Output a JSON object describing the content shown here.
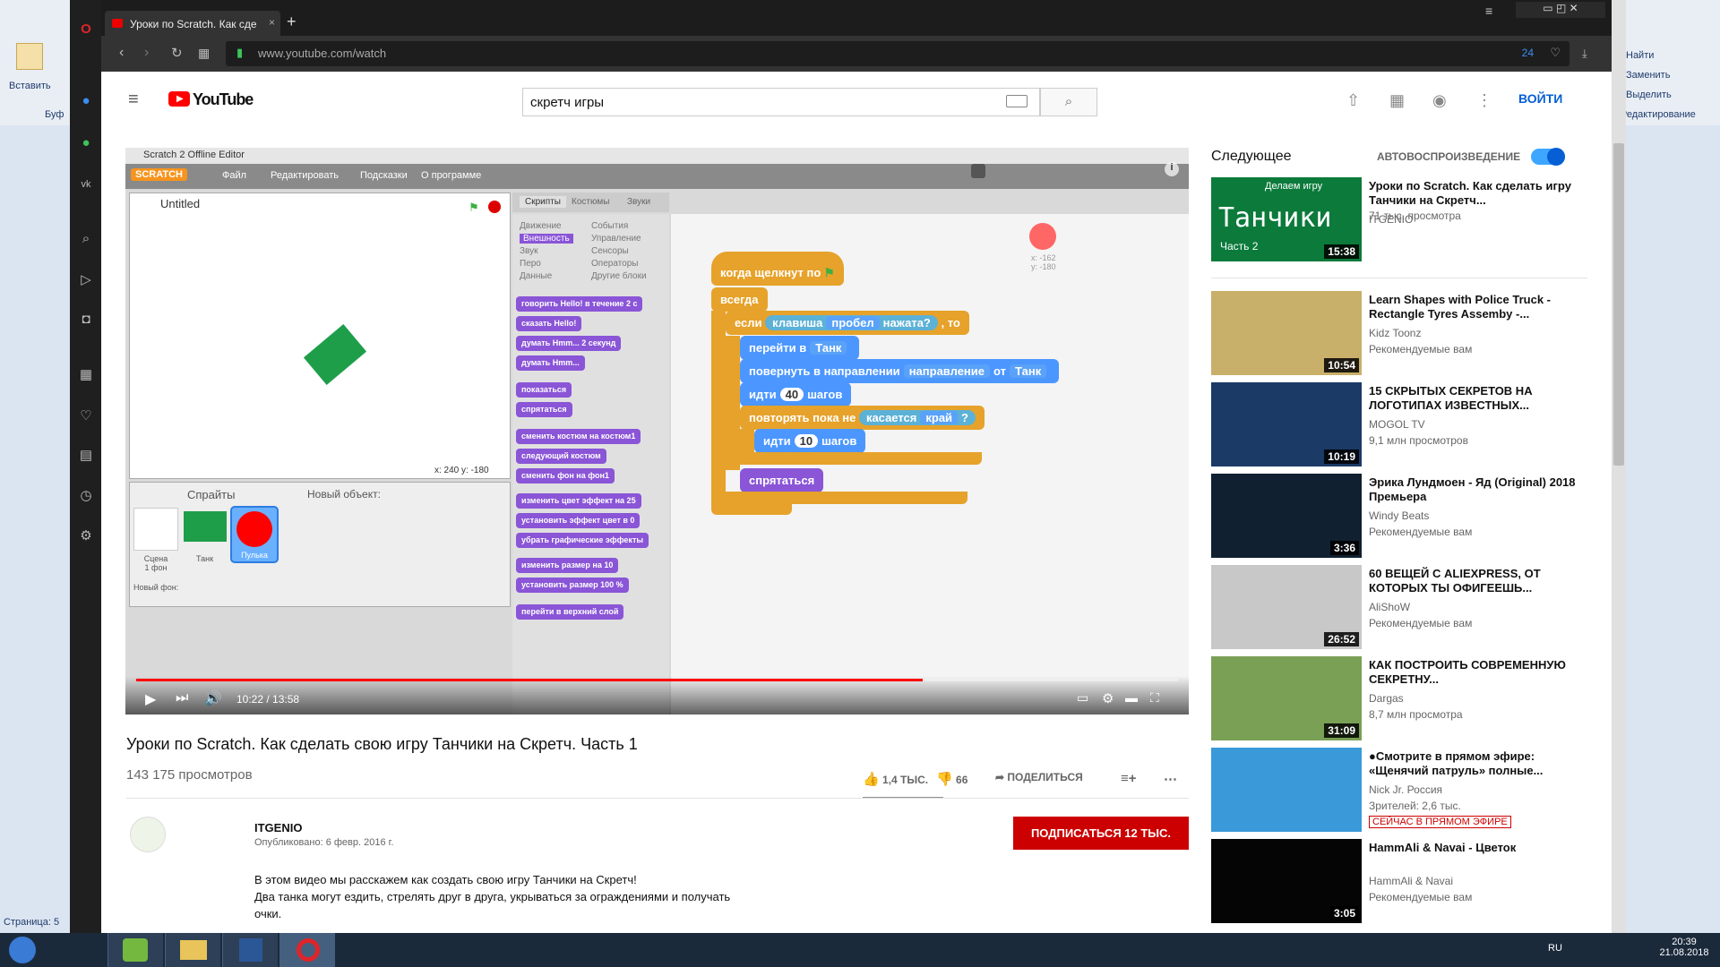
{
  "word": {
    "paste_label": "Вставить",
    "buffer_label": "Буф",
    "page_label": "Страница: 5",
    "right_items": [
      "Найти",
      "Заменить",
      "Выделить",
      "Редактирование"
    ]
  },
  "browser": {
    "tab_title": "Уроки по Scratch. Как сде",
    "url": "www.youtube.com/watch",
    "badge_count": "24"
  },
  "youtube": {
    "logo": "YouTube",
    "search_value": "скретч игры",
    "signin": "ВОЙТИ"
  },
  "video": {
    "scratch_window_title": "Scratch 2 Offline Editor",
    "menu": [
      "Файл",
      "Редактировать",
      "Подсказки",
      "О программе"
    ],
    "project_name": "Untitled",
    "tabs": [
      "Скрипты",
      "Костюмы",
      "Звуки"
    ],
    "categories_left": [
      "Движение",
      "Внешность",
      "Звук",
      "Перо",
      "Данные"
    ],
    "categories_right": [
      "События",
      "Управление",
      "Сенсоры",
      "Операторы",
      "Другие блоки"
    ],
    "palette_blocks": [
      "говорить Hello! в течение 2 с",
      "сказать Hello!",
      "думать Hmm... 2 секунд",
      "думать Hmm...",
      "показаться",
      "спрятаться",
      "сменить костюм на костюм1",
      "следующий костюм",
      "сменить фон на фон1",
      "изменить цвет эффект на 25",
      "установить эффект цвет в 0",
      "убрать графические эффекты",
      "изменить размер на 10",
      "установить размер 100 %",
      "перейти в верхний слой"
    ],
    "script": {
      "hat": "когда щелкнут по",
      "forever": "всегда",
      "if": "если",
      "key": "клавиша",
      "key_value": "пробел",
      "pressed": "нажата?",
      "then": ", то",
      "goto": "перейти в",
      "goto_value": "Танк",
      "turn": "повернуть в направлении",
      "direction": "направление",
      "of": "от",
      "of_value": "Танк",
      "move": "идти",
      "move_steps": "40",
      "steps": "шагов",
      "repeat_until": "повторять пока не",
      "touching": "касается",
      "edge": "край",
      "q": "?",
      "move2_steps": "10",
      "hide": "спрятаться"
    },
    "coords": "x: 240  y: -180",
    "xy_small": "x: -162\ny: -180",
    "sprites_label": "Спрайты",
    "new_object": "Новый объект:",
    "stage_label": "Сцена\n1 фон",
    "new_backdrop": "Новый фон:",
    "sprite_names": [
      "Танк",
      "Пулька"
    ],
    "time": "10:22 / 13:58",
    "progress": 0.755
  },
  "info": {
    "title": "Уроки по Scratch. Как сделать свою игру Танчики на Скретч. Часть 1",
    "views": "143 175 просмотров",
    "likes": "1,4 ТЫС.",
    "dislikes": "66",
    "share": "ПОДЕЛИТЬСЯ",
    "channel": "ITGENIO",
    "published": "Опубликовано: 6 февр. 2016 г.",
    "subscribe": "ПОДПИСАТЬСЯ",
    "subs": "12 ТЫС.",
    "desc": [
      "В этом видео мы расскажем как создать свою игру Танчики на Скретч!",
      "Два танка могут ездить, стрелять друг в друга,  укрываться за ограждениями и получать",
      "очки."
    ]
  },
  "sidebar": {
    "next": "Следующее",
    "autoplay": "АВТОВОСПРОИЗВЕДЕНИЕ",
    "recs": [
      {
        "title": "Уроки по Scratch. Как сделать игру Танчики на Скретч...",
        "channel": "ITGENIO",
        "meta": "71 тыс. просмотра",
        "dur": "15:38",
        "thumb_text": "Танчики",
        "thumb_sub": "Часть 2",
        "thumb_top": "Делаем игру",
        "bg": "#0b7a3b"
      },
      {
        "title": "Learn Shapes with Police Truck - Rectangle Tyres Assemby -...",
        "channel": "Kidz Toonz",
        "meta": "Рекомендуемые вам",
        "dur": "10:54",
        "bg": "#c9b06a"
      },
      {
        "title": "15 СКРЫТЫХ СЕКРЕТОВ НА ЛОГОТИПАХ ИЗВЕСТНЫХ...",
        "channel": "MOGOL TV",
        "meta": "9,1 млн просмотров",
        "dur": "10:19",
        "bg": "#1b3a66"
      },
      {
        "title": "Эрика Лундмоен - Яд (Original) 2018 Премьера",
        "channel": "Windy Beats",
        "meta": "Рекомендуемые вам",
        "dur": "3:36",
        "bg": "#102030"
      },
      {
        "title": "60 ВЕЩЕЙ С ALIEXPRESS, ОТ КОТОРЫХ ТЫ ОФИГЕЕШЬ...",
        "channel": "AliShoW",
        "meta": "Рекомендуемые вам",
        "dur": "26:52",
        "bg": "#c8c8c8"
      },
      {
        "title": "КАК ПОСТРОИТЬ СОВРЕМЕННУЮ СЕКРЕТНУ...",
        "channel": "Dargas",
        "meta": "8,7 млн просмотра",
        "dur": "31:09",
        "bg": "#7aa055"
      },
      {
        "title": "●Смотрите в прямом эфире: «Щенячий патруль» полные...",
        "channel": "Nick Jr. Россия",
        "meta": "Зрителей: 2,6 тыс.",
        "live": "СЕЙЧАС В ПРЯМОМ ЭФИРЕ",
        "bg": "#3a9ad9"
      },
      {
        "title": "HammAli & Navai - Цветок",
        "channel": "HammAli & Navai",
        "meta": "Рекомендуемые вам",
        "dur": "3:05",
        "bg": "#050505"
      }
    ]
  },
  "taskbar": {
    "lang": "RU",
    "time": "20:39",
    "date": "21.08.2018"
  }
}
